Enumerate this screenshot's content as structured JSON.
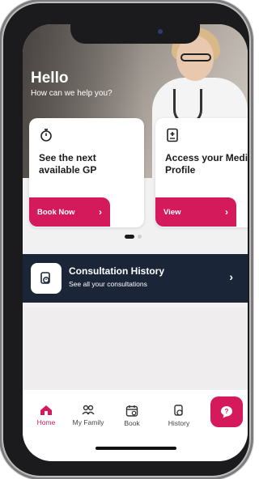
{
  "hero": {
    "greeting": "Hello",
    "subtitle": "How can we help you?"
  },
  "cards": [
    {
      "icon": "stopwatch-icon",
      "title": "See the next available GP",
      "button": "Book Now"
    },
    {
      "icon": "medical-profile-icon",
      "title": "Access your Medical Profile",
      "button": "View"
    }
  ],
  "carousel": {
    "page_count": 2,
    "active_index": 0
  },
  "history": {
    "icon": "consultation-history-icon",
    "title": "Consultation History",
    "subtitle": "See all your consultations"
  },
  "tabs": [
    {
      "label": "Home",
      "icon": "home-icon",
      "active": true
    },
    {
      "label": "My Family",
      "icon": "family-icon",
      "active": false
    },
    {
      "label": "Book",
      "icon": "calendar-icon",
      "active": false
    },
    {
      "label": "History",
      "icon": "history-icon",
      "active": false
    }
  ],
  "fab": {
    "icon": "help-chat-icon"
  },
  "colors": {
    "accent": "#d41a5b",
    "dark_banner": "#1a2638"
  }
}
